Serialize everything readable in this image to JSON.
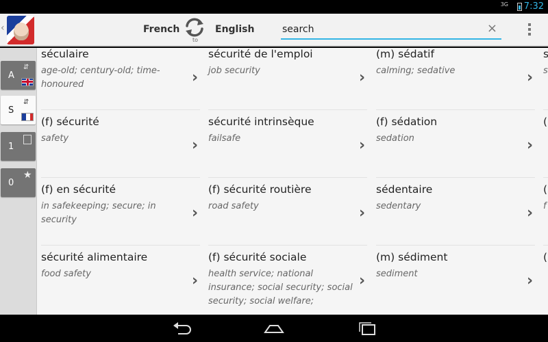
{
  "status_bar": {
    "network": "3G",
    "time": "7:32"
  },
  "header": {
    "source_language": "French",
    "target_language": "English",
    "swap_caption": "to",
    "search": {
      "value": "",
      "placeholder": "search"
    }
  },
  "rail": {
    "tabs": [
      {
        "label": "A",
        "flag": "uk-flag-icon"
      },
      {
        "label": "S",
        "flag": "fr-flag-icon"
      },
      {
        "label": "1"
      },
      {
        "label": "0"
      }
    ]
  },
  "entries": [
    [
      {
        "term": "séculaire",
        "translation": "age-old; century-old; time-honoured"
      },
      {
        "term": "sécurité de l'emploi",
        "translation": "job security"
      },
      {
        "term": "(m) sédatif",
        "translation": "calming; sedative"
      },
      {
        "term": "s",
        "translation": "s"
      }
    ],
    [
      {
        "term": "(f) sécurité",
        "translation": "safety"
      },
      {
        "term": "sécurité intrinsèque",
        "translation": "failsafe"
      },
      {
        "term": "(f) sédation",
        "translation": "sedation"
      },
      {
        "term": "(",
        "translation": ""
      }
    ],
    [
      {
        "term": "(f) en sécurité",
        "translation": "in safekeeping; secure; in security"
      },
      {
        "term": "(f) sécurité routière",
        "translation": "road safety"
      },
      {
        "term": "sédentaire",
        "translation": "sedentary"
      },
      {
        "term": "(",
        "translation": "f"
      }
    ],
    [
      {
        "term": "sécurité alimentaire",
        "translation": "food safety"
      },
      {
        "term": "(f) sécurité sociale",
        "translation": "health service; national insurance; social security; social security; social welfare;"
      },
      {
        "term": "(m) sédiment",
        "translation": "sediment"
      },
      {
        "term": "(",
        "translation": ""
      }
    ]
  ],
  "chevron": "›",
  "clear_glyph": "×",
  "colors": {
    "accent": "#33b5e5",
    "rail_tab": "#747474",
    "list_bg": "#f5f5f5"
  }
}
